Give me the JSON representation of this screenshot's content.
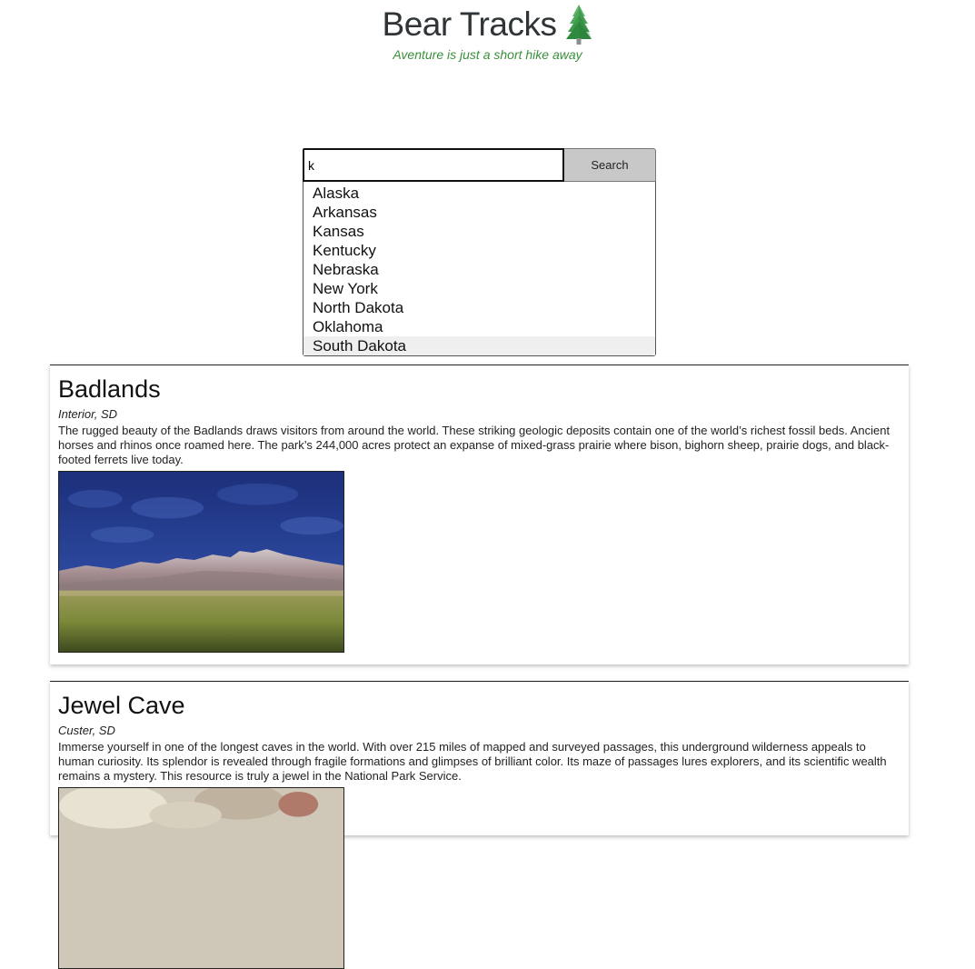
{
  "header": {
    "title": "Bear Tracks",
    "tagline": "Aventure is just a short hike away",
    "logo_icon": "evergreen-tree-icon"
  },
  "search": {
    "value": "k",
    "button_label": "Search",
    "suggestions": [
      "Alaska",
      "Arkansas",
      "Kansas",
      "Kentucky",
      "Nebraska",
      "New York",
      "North Dakota",
      "Oklahoma",
      "South Dakota"
    ],
    "highlighted": "South Dakota"
  },
  "parks": [
    {
      "name": "Badlands",
      "location": "Interior, SD",
      "description": "The rugged beauty of the Badlands draws visitors from around the world. These striking geologic deposits contain one of the world’s richest fossil beds. Ancient horses and rhinos once roamed here. The park’s 244,000 acres protect an expanse of mixed-grass prairie where bison, bighorn sheep, prairie dogs, and black-footed ferrets live today."
    },
    {
      "name": "Jewel Cave",
      "location": "Custer, SD",
      "description": "Immerse yourself in one of the longest caves in the world. With over 215 miles of mapped and surveyed passages, this underground wilderness appeals to human curiosity. Its splendor is revealed through fragile formations and glimpses of brilliant color. Its maze of passages lures explorers, and its scientific wealth remains a mystery. This resource is truly a jewel in the National Park Service."
    }
  ],
  "colors": {
    "tagline": "#3a8f3a",
    "title": "#2f3437",
    "button_bg": "#c8c8c8",
    "dropdown_highlight": "#efefef"
  }
}
